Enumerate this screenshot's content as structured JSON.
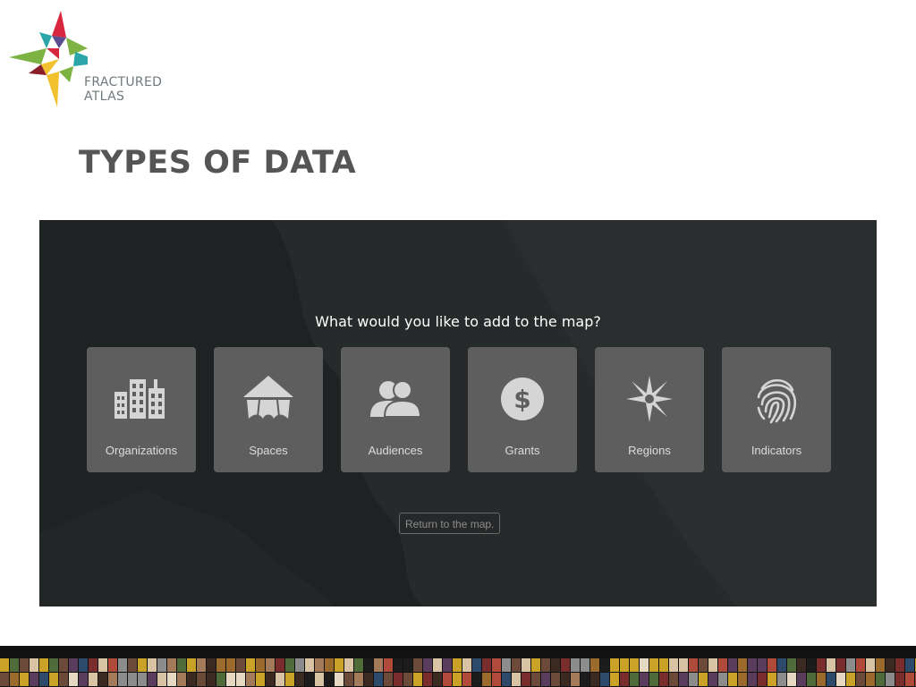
{
  "logo": {
    "line1": "FRACTURED",
    "line2": "ATLAS"
  },
  "slide": {
    "title": "TYPES OF DATA"
  },
  "dialog": {
    "prompt": "What would you like to add to the map?",
    "options": [
      {
        "label": "Organizations",
        "icon": "buildings-icon"
      },
      {
        "label": "Spaces",
        "icon": "tent-icon"
      },
      {
        "label": "Audiences",
        "icon": "people-icon"
      },
      {
        "label": "Grants",
        "icon": "dollar-icon"
      },
      {
        "label": "Regions",
        "icon": "compass-icon"
      },
      {
        "label": "Indicators",
        "icon": "fingerprint-icon"
      }
    ],
    "return_label": "Return to the map."
  },
  "colors": {
    "panel_bg": "#1f2223",
    "card_bg": "#5e5e5e",
    "icon_fill": "#d5d5d5",
    "title_text": "#555555",
    "logo_red": "#d7263d",
    "logo_teal": "#2aa6a8",
    "logo_green": "#7cb342",
    "logo_yellow": "#f2c12e",
    "logo_purple": "#5b4c8f",
    "logo_maroon": "#8b1e2b"
  }
}
